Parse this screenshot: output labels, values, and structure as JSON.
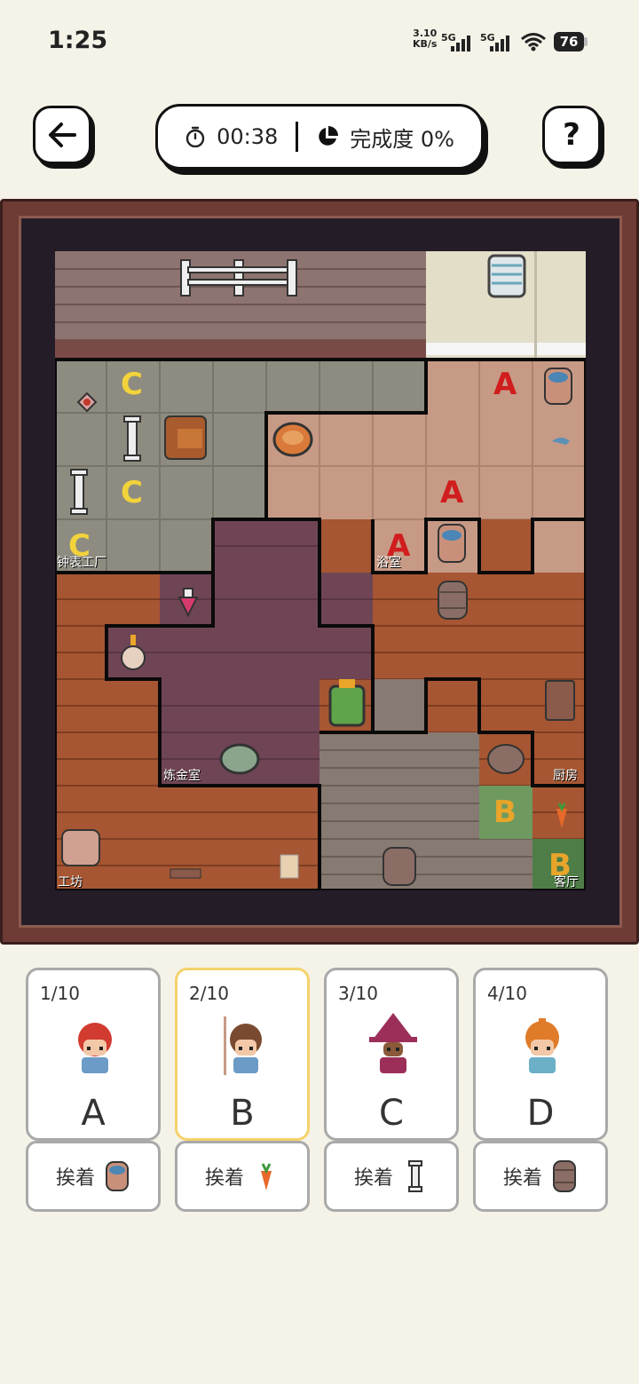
{
  "status": {
    "time": "1:25",
    "net_speed_top": "3.10",
    "net_speed_bottom": "KB/s",
    "signal1": "5G",
    "signal2": "5G",
    "battery": "76"
  },
  "header": {
    "timer": "00:38",
    "completion": "完成度 0%",
    "help": "?"
  },
  "rooms": {
    "clock_factory": "钟表工厂",
    "bathroom": "浴室",
    "alchemy": "炼金室",
    "kitchen": "厨房",
    "workshop": "工坊",
    "hall": "客厅"
  },
  "map_letters": [
    "C",
    "A",
    "C",
    "A",
    "C",
    "A",
    "B",
    "B"
  ],
  "cards": [
    {
      "count": "1/10",
      "letter": "A",
      "hint": "挨着",
      "hint_icon": "bucket-icon"
    },
    {
      "count": "2/10",
      "letter": "B",
      "hint": "挨着",
      "hint_icon": "carrot-icon"
    },
    {
      "count": "3/10",
      "letter": "C",
      "hint": "挨着",
      "hint_icon": "candle-stand-icon"
    },
    {
      "count": "4/10",
      "letter": "D",
      "hint": "挨着",
      "hint_icon": "barrel-icon"
    }
  ],
  "colors": {
    "selected_card_border": "#f4d36b",
    "letter_a": "#d01d1d",
    "letter_b": "#e8a52a",
    "letter_c": "#f2d33b"
  }
}
